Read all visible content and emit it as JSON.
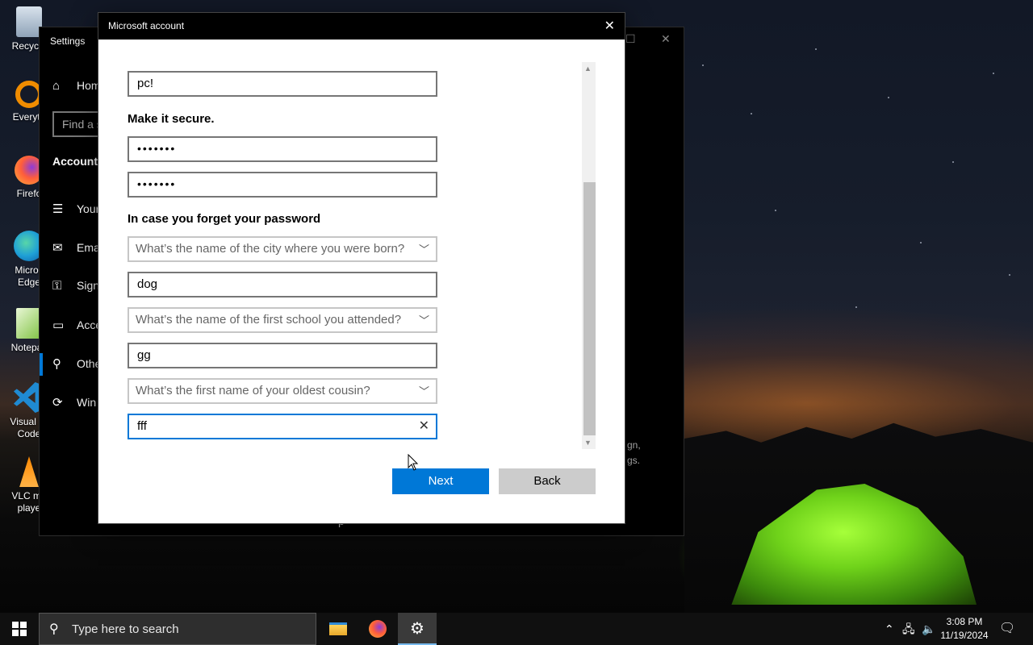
{
  "desktop": {
    "icons": [
      {
        "label": "Recycle",
        "icon": "recycle-bin-icon",
        "color": "#9fb4c8"
      },
      {
        "label": "Everyth",
        "icon": "everything-icon",
        "color": "#f08c00"
      },
      {
        "label": "Firefo",
        "icon": "firefox-icon",
        "color": "#ff7139"
      },
      {
        "label": "Micros Edge",
        "icon": "edge-icon",
        "color": "#1fa0d6"
      },
      {
        "label": "Notepac",
        "icon": "notepad-icon",
        "color": "#7fc242"
      },
      {
        "label": "Visual St Code",
        "icon": "vscode-icon",
        "color": "#1f8ad2"
      },
      {
        "label": "VLC me playe",
        "icon": "vlc-icon",
        "color": "#ff8800"
      }
    ]
  },
  "settings_window": {
    "title": "Settings",
    "home": "Hom",
    "search_placeholder": "Find a s",
    "section": "Accounts",
    "items": [
      "Your",
      "Ema",
      "Sign",
      "Acce",
      "Othe",
      "Win"
    ],
    "faint_line1": "gn,",
    "faint_line2": "gs.",
    "bottom_char": "p"
  },
  "dialog": {
    "title": "Microsoft account",
    "username_value": "pc!",
    "secure_label": "Make it secure.",
    "password_value": "•••••••",
    "confirm_password_value": "•••••••",
    "forget_label": "In case you forget your password",
    "q1_placeholder": "What’s the name of the city where you were born?",
    "a1_value": "dog",
    "q2_placeholder": "What’s the name of the first school you attended?",
    "a2_value": "gg",
    "q3_placeholder": "What’s the first name of your oldest cousin?",
    "a3_value": "fff",
    "next_label": "Next",
    "back_label": "Back"
  },
  "taskbar": {
    "search_placeholder": "Type here to search",
    "apps": [
      "file-explorer-icon",
      "firefox-icon",
      "settings-gear-icon"
    ],
    "time": "3:08 PM",
    "date": "11/19/2024"
  }
}
